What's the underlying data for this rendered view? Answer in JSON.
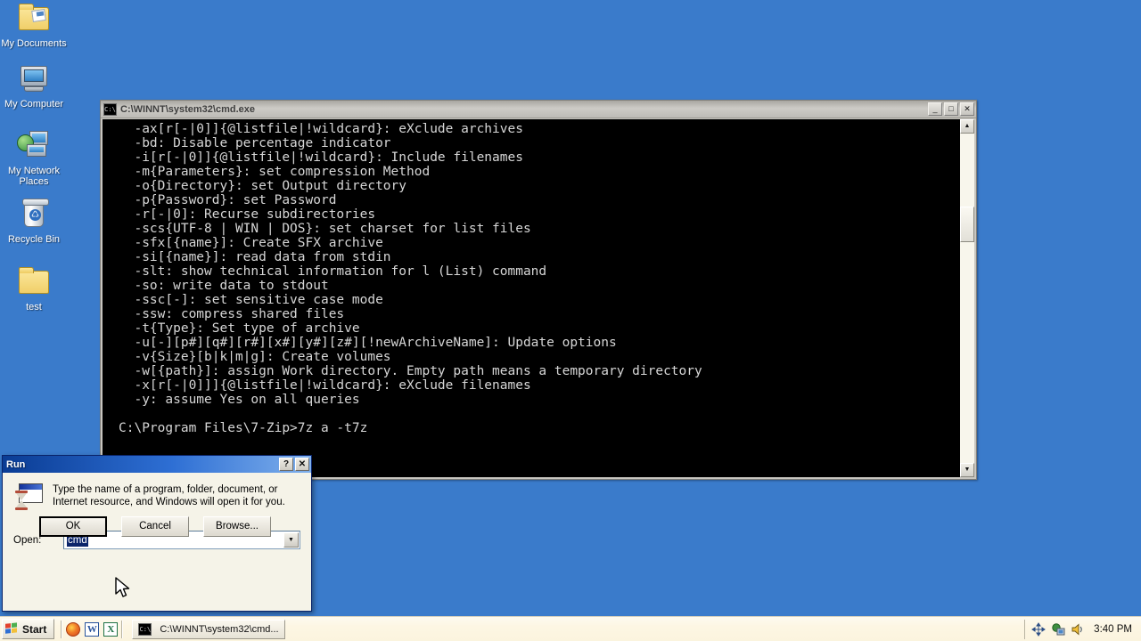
{
  "desktop": {
    "background_color": "#3a7bcb",
    "icons": [
      {
        "label": "My Documents",
        "icon": "documents-folder-icon"
      },
      {
        "label": "My Computer",
        "icon": "computer-icon"
      },
      {
        "label": "My Network Places",
        "icon": "network-places-icon"
      },
      {
        "label": "Recycle Bin",
        "icon": "recycle-bin-icon"
      },
      {
        "label": "test",
        "icon": "folder-icon"
      }
    ]
  },
  "console_window": {
    "title": "C:\\WINNT\\system32\\cmd.exe",
    "icon": "cmd-icon",
    "minimize_label": "_",
    "maximize_label": "□",
    "close_label": "✕",
    "scrollbar": {
      "up_arrow": "▲",
      "down_arrow": "▼"
    },
    "lines": [
      "  -ax[r[-|0]]{@listfile|!wildcard}: eXclude archives",
      "  -bd: Disable percentage indicator",
      "  -i[r[-|0]]{@listfile|!wildcard}: Include filenames",
      "  -m{Parameters}: set compression Method",
      "  -o{Directory}: set Output directory",
      "  -p{Password}: set Password",
      "  -r[-|0]: Recurse subdirectories",
      "  -scs{UTF-8 | WIN | DOS}: set charset for list files",
      "  -sfx[{name}]: Create SFX archive",
      "  -si[{name}]: read data from stdin",
      "  -slt: show technical information for l (List) command",
      "  -so: write data to stdout",
      "  -ssc[-]: set sensitive case mode",
      "  -ssw: compress shared files",
      "  -t{Type}: Set type of archive",
      "  -u[-][p#][q#][r#][x#][y#][z#][!newArchiveName]: Update options",
      "  -v{Size}[b|k|m|g]: Create volumes",
      "  -w[{path}]: assign Work directory. Empty path means a temporary directory",
      "  -x[r[-|0]]]{@listfile|!wildcard}: eXclude filenames",
      "  -y: assume Yes on all queries",
      "",
      "C:\\Program Files\\7-Zip>7z a -t7z"
    ]
  },
  "run_dialog": {
    "title": "Run",
    "icon": "run-hourglass-icon",
    "help_label": "?",
    "close_label": "✕",
    "description": "Type the name of a program, folder, document, or Internet resource, and Windows will open it for you.",
    "open_label": "Open:",
    "open_value": "cmd",
    "combo_arrow": "▼",
    "buttons": {
      "ok": "OK",
      "cancel": "Cancel",
      "browse": "Browse..."
    }
  },
  "taskbar": {
    "start_label": "Start",
    "quick_launch": [
      {
        "name": "firefox-icon",
        "label": ""
      },
      {
        "name": "word-icon",
        "label": "W"
      },
      {
        "name": "excel-icon",
        "label": "X"
      }
    ],
    "tasks": [
      {
        "label": "C:\\WINNT\\system32\\cmd...",
        "icon": "cmd-icon"
      }
    ],
    "tray_icons": [
      "network-move-icon",
      "network-connection-icon",
      "volume-icon"
    ],
    "clock": "3:40 PM"
  }
}
